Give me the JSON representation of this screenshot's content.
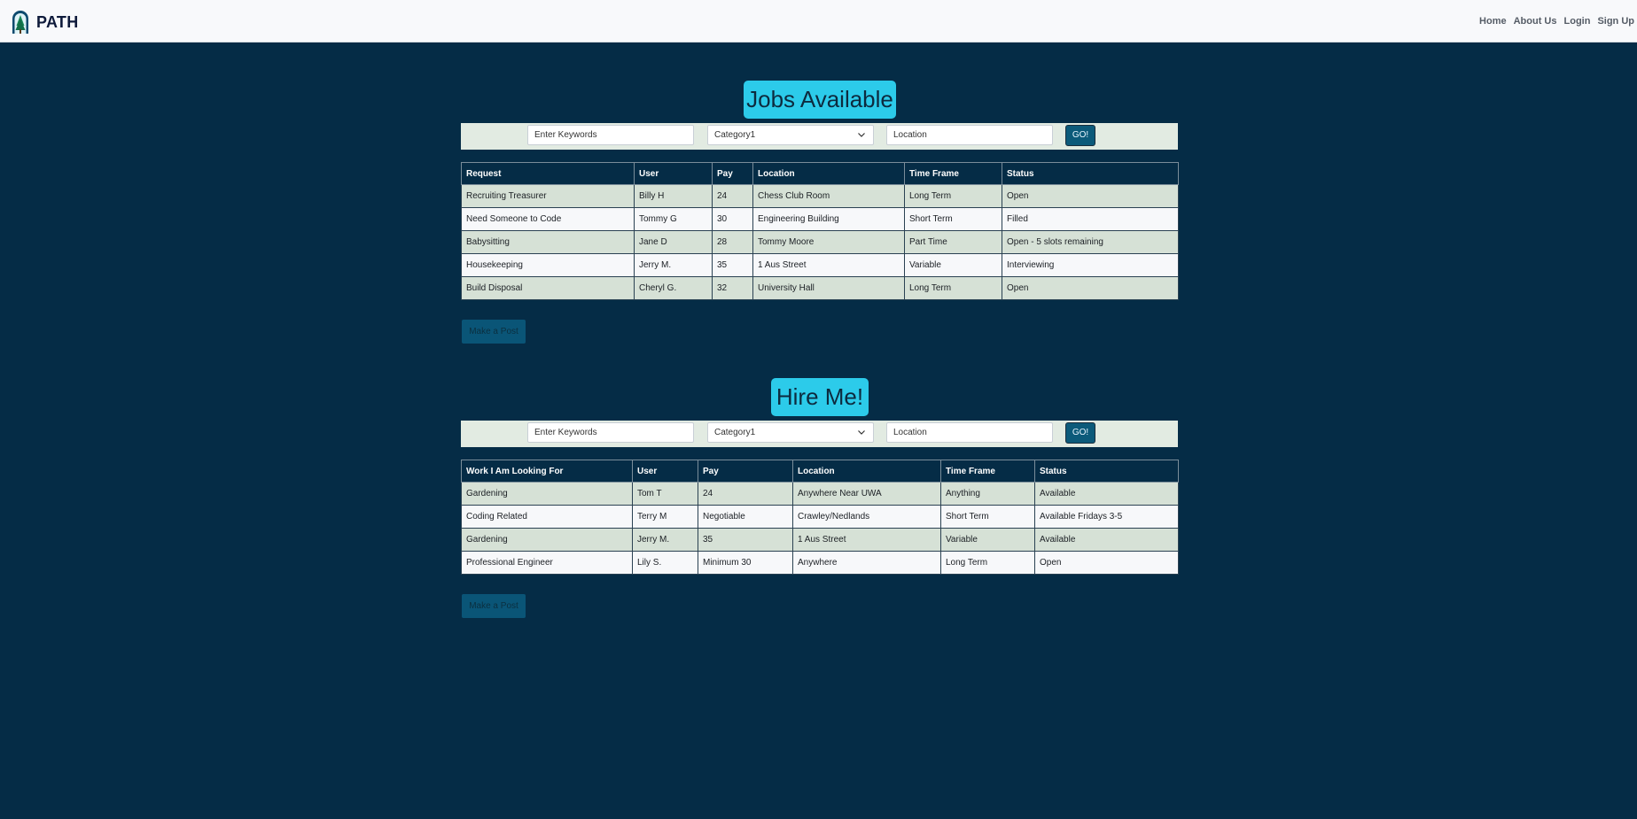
{
  "brand": {
    "name": "PATH"
  },
  "nav": {
    "items": [
      "Home",
      "About Us",
      "Login",
      "Sign Up"
    ]
  },
  "jobs": {
    "title": "Jobs Available",
    "search": {
      "keywords_placeholder": "Enter Keywords",
      "category_value": "Category1",
      "location_placeholder": "Location",
      "go_label": "GO!"
    },
    "table": {
      "headers": [
        "Request",
        "User",
        "Pay",
        "Location",
        "Time Frame",
        "Status"
      ],
      "rows": [
        [
          "Recruiting Treasurer",
          "Billy H",
          "24",
          "Chess Club Room",
          "Long Term",
          "Open"
        ],
        [
          "Need Someone to Code",
          "Tommy G",
          "30",
          "Engineering Building",
          "Short Term",
          "Filled"
        ],
        [
          "Babysitting",
          "Jane D",
          "28",
          "Tommy Moore",
          "Part Time",
          "Open - 5 slots remaining"
        ],
        [
          "Housekeeping",
          "Jerry M.",
          "35",
          "1 Aus Street",
          "Variable",
          "Interviewing"
        ],
        [
          "Build Disposal",
          "Cheryl G.",
          "32",
          "University Hall",
          "Long Term",
          "Open"
        ]
      ]
    },
    "post_button": "Make a Post"
  },
  "hire": {
    "title": "Hire Me!",
    "search": {
      "keywords_placeholder": "Enter Keywords",
      "category_value": "Category1",
      "location_placeholder": "Location",
      "go_label": "GO!"
    },
    "table": {
      "headers": [
        "Work I Am Looking For",
        "User",
        "Pay",
        "Location",
        "Time Frame",
        "Status"
      ],
      "rows": [
        [
          "Gardening",
          "Tom T",
          "24",
          "Anywhere Near UWA",
          "Anything",
          "Available"
        ],
        [
          "Coding Related",
          "Terry M",
          "Negotiable",
          "Crawley/Nedlands",
          "Short Term",
          "Available Fridays 3-5"
        ],
        [
          "Gardening",
          "Jerry M.",
          "35",
          "1 Aus Street",
          "Variable",
          "Available"
        ],
        [
          "Professional Engineer",
          "Lily S.",
          "Minimum 30",
          "Anywhere",
          "Long Term",
          "Open"
        ]
      ]
    },
    "post_button": "Make a Post"
  },
  "colors": {
    "page_background": "#052c46",
    "title_accent": "#2ccbea",
    "row_odd": "#d6e1d6",
    "row_even": "#f7f8fa",
    "button": "#0c5a7a"
  },
  "icons": {
    "logo": "arch-tree-logo-icon",
    "dropdown": "chevron-down-icon"
  }
}
